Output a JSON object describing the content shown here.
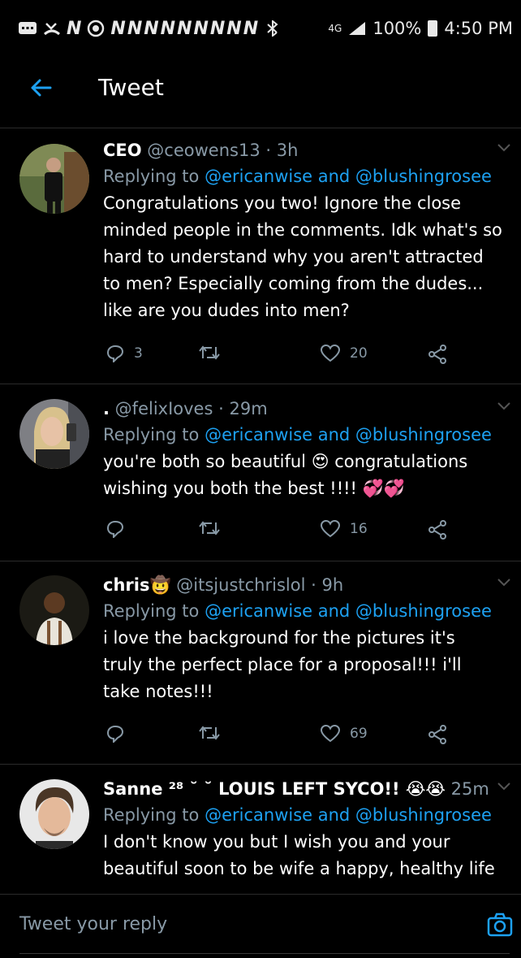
{
  "status_bar": {
    "left_icons": [
      "message-icon",
      "missed-call-icon",
      "notification-n-icon",
      "location-icon"
    ],
    "n_count": 9,
    "network": "4G",
    "battery": "100%",
    "time": "4:50 PM"
  },
  "header": {
    "title": "Tweet"
  },
  "colors": {
    "accent": "#1da1f2",
    "muted": "#8899a6",
    "background": "#000000"
  },
  "tweets": [
    {
      "name": "CEO",
      "handle": "@ceowens13",
      "time": "3h",
      "replying_prefix": "Replying to ",
      "mention1": "@ericanwise",
      "and": " and ",
      "mention2": "@blushingrosee",
      "text_lines": [
        "Congratulations you two! Ignore the close",
        "minded people in the comments. Idk what's so",
        "hard to understand why you aren't attracted",
        "to men? Especially coming from the dudes...",
        "like are you dudes into men?"
      ],
      "replies": "3",
      "retweets": "",
      "likes": "20"
    },
    {
      "name": ".",
      "handle": "@felixIoves",
      "time": "29m",
      "replying_prefix": "Replying to ",
      "mention1": "@ericanwise",
      "and": " and ",
      "mention2": "@blushingrosee",
      "text_lines": [
        "you're both so beautiful 😍 congratulations",
        "wishing you both the best !!!! 💞💞"
      ],
      "replies": "",
      "retweets": "",
      "likes": "16"
    },
    {
      "name": "chris🤠",
      "handle": "@itsjustchrislol",
      "time": "9h",
      "replying_prefix": "Replying to ",
      "mention1": "@ericanwise",
      "and": " and ",
      "mention2": "@blushingrosee",
      "text_lines": [
        "i love the background for the pictures it's",
        "truly the perfect place for a proposal!!! i'll",
        "take notes!!!"
      ],
      "replies": "",
      "retweets": "",
      "likes": "69"
    },
    {
      "name": "Sanne ²⁸ ˘ ˘ LOUIS LEFT SYCO!! 😭😭",
      "handle": "",
      "time": "25m",
      "replying_prefix": "Replying to ",
      "mention1": "@ericanwise",
      "and": " and ",
      "mention2": "@blushingrosee",
      "text_lines": [
        "I don't know you but I wish you and your",
        "beautiful soon to be wife a happy, healthy life"
      ]
    }
  ],
  "reply_bar": {
    "placeholder": "Tweet your reply"
  }
}
